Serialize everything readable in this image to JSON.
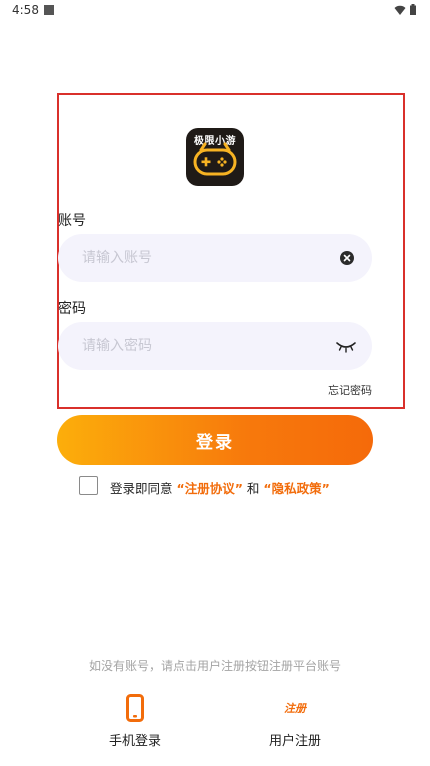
{
  "status_bar": {
    "time": "4:58"
  },
  "logo": {
    "text": "极限小游"
  },
  "form": {
    "account_label": "账号",
    "account_placeholder": "请输入账号",
    "password_label": "密码",
    "password_placeholder": "请输入密码",
    "forgot_password": "忘记密码"
  },
  "login_button": "登录",
  "agreement": {
    "prefix": "登录即同意",
    "terms": "“注册协议”",
    "and": "和",
    "privacy": "“隐私政策”"
  },
  "bottom": {
    "hint": "如没有账号，请点击用户注册按钮注册平台账号",
    "phone_login": "手机登录",
    "register_icon_text": "注册",
    "user_register": "用户注册"
  },
  "colors": {
    "accent": "#f26c0b",
    "button_start": "#fcae0b",
    "button_end": "#f56a0a",
    "input_bg": "#f4f3fc",
    "highlight": "#d9302b"
  },
  "icons": [
    "wifi-icon",
    "battery-icon",
    "clear-icon",
    "eye-closed-icon",
    "phone-icon"
  ]
}
